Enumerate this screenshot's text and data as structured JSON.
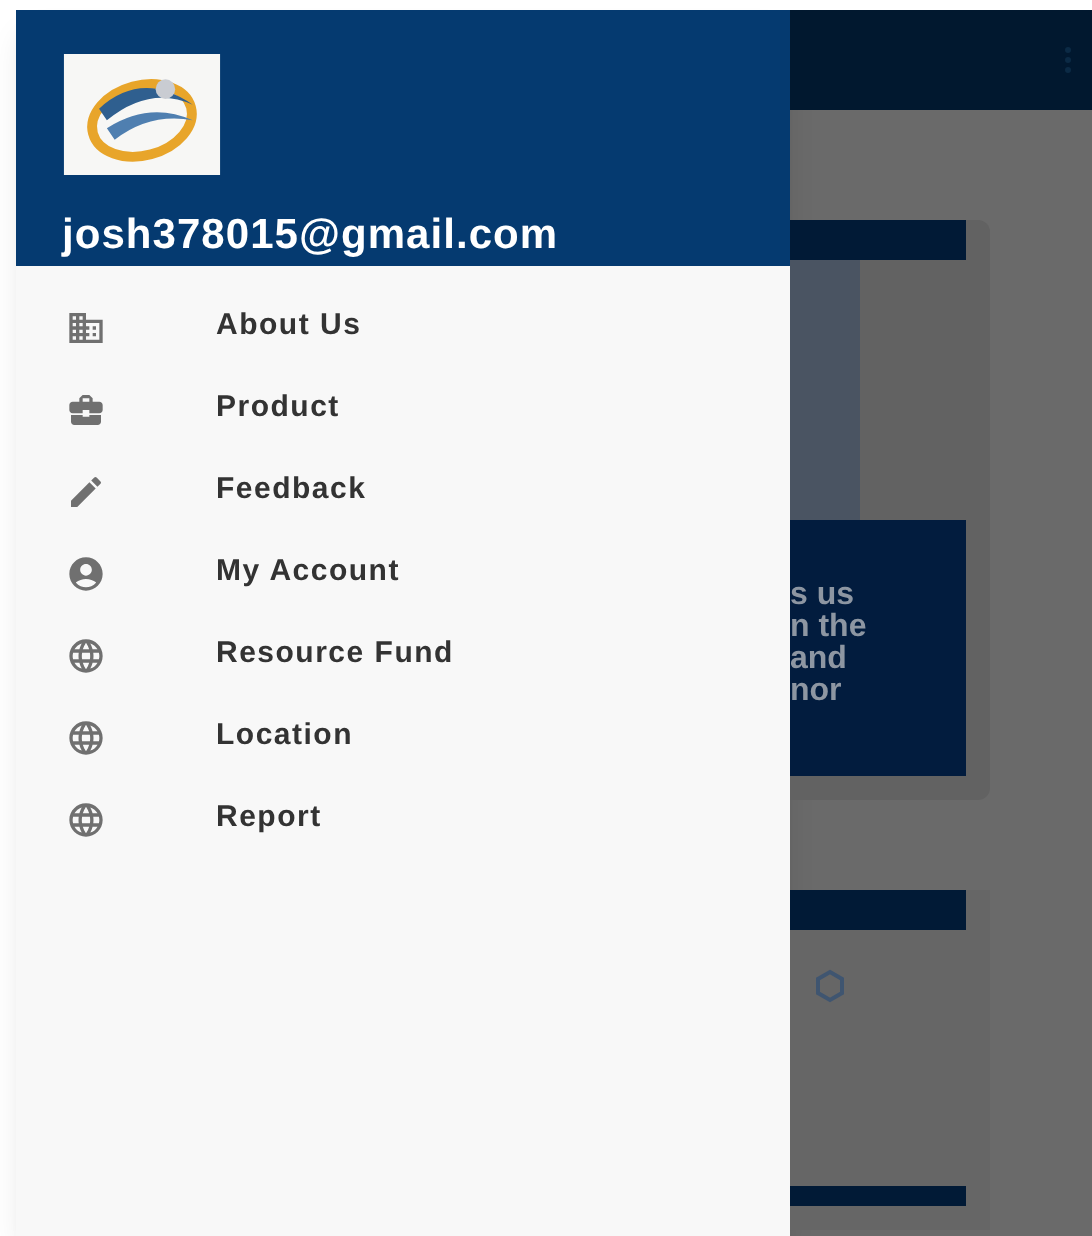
{
  "drawer": {
    "email": "josh378015@gmail.com",
    "items": [
      {
        "label": "About Us"
      },
      {
        "label": "Product"
      },
      {
        "label": "Feedback"
      },
      {
        "label": "My Account"
      },
      {
        "label": "Resource Fund"
      },
      {
        "label": "Location"
      },
      {
        "label": "Report"
      }
    ]
  },
  "background": {
    "card_text": [
      "s us",
      "n the",
      "and",
      "nor"
    ]
  }
}
